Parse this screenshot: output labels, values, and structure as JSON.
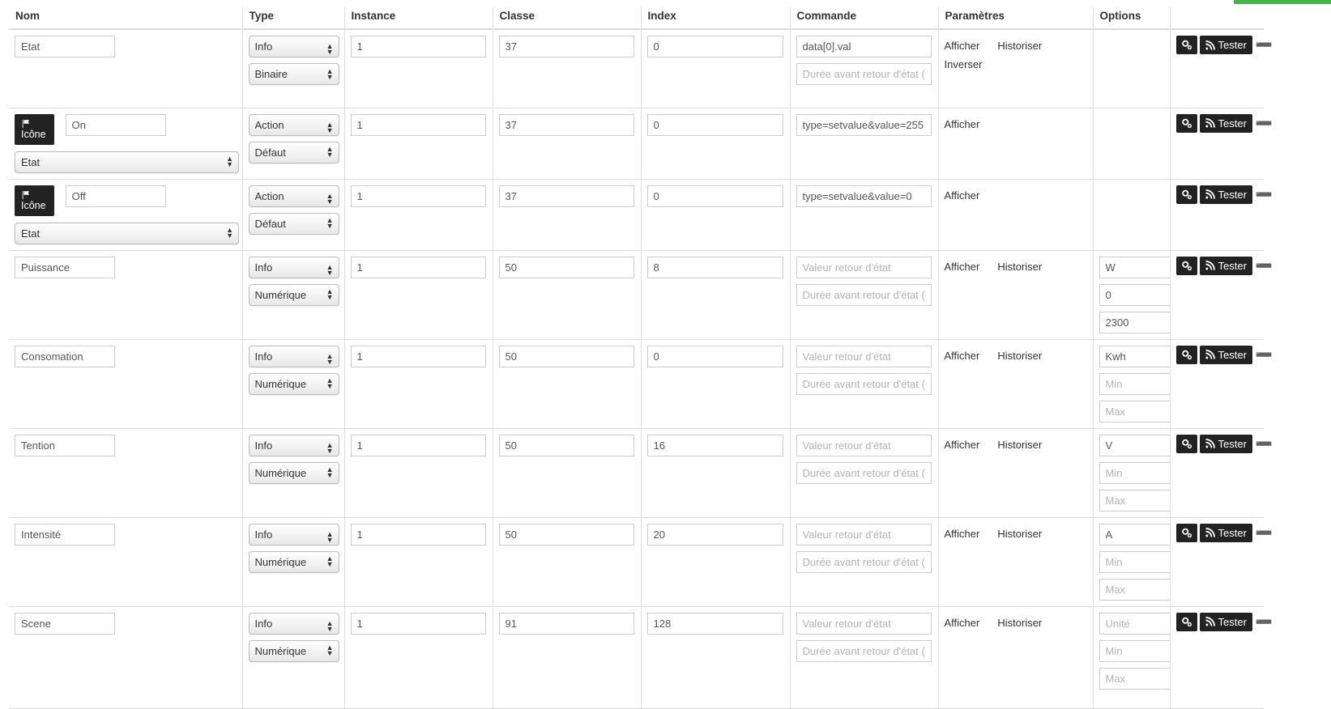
{
  "accent_green": "#44b549",
  "table": {
    "headers": [
      "Nom",
      "Type",
      "Instance",
      "Classe",
      "Index",
      "Commande",
      "Paramètres",
      "Options",
      ""
    ],
    "placeholders": {
      "valeur_retour": "Valeur retour d'état",
      "duree_retour": "Durée avant retour d'état (m",
      "unite": "Unité",
      "min": "Min",
      "max": "Max"
    },
    "buttons": {
      "gear_icon": "gears-icon",
      "test_label": "Tester",
      "test_icon": "rss-icon",
      "remove_icon": "minus-circle-icon"
    },
    "badge_label": "Icône",
    "badge_icon": "flag-icon",
    "rows": [
      {
        "kind": "plain",
        "nom": "Etat",
        "type1": "Info",
        "type2": "Binaire",
        "instance": "1",
        "classe": "37",
        "index": "0",
        "cmd1": "data[0].val",
        "cmd1_placeholder": "Valeur retour d'état",
        "cmd2": "",
        "params": [
          "Afficher",
          "Historiser",
          "Inverser"
        ],
        "options": []
      },
      {
        "kind": "icon",
        "nom": "On",
        "icon_select": "Etat",
        "type1": "Action",
        "type2": "Défaut",
        "instance": "1",
        "classe": "37",
        "index": "0",
        "cmd1": "type=setvalue&value=255",
        "cmd1_placeholder": "Valeur retour d'état",
        "params": [
          "Afficher"
        ],
        "options": []
      },
      {
        "kind": "icon",
        "nom": "Off",
        "icon_select": "Etat",
        "type1": "Action",
        "type2": "Défaut",
        "instance": "1",
        "classe": "37",
        "index": "0",
        "cmd1": "type=setvalue&value=0",
        "cmd1_placeholder": "Valeur retour d'état",
        "params": [
          "Afficher"
        ],
        "options": []
      },
      {
        "kind": "plain",
        "nom": "Puissance",
        "type1": "Info",
        "type2": "Numérique",
        "instance": "1",
        "classe": "50",
        "index": "8",
        "cmd1": "",
        "cmd1_placeholder": "Valeur retour d'état",
        "cmd2": "",
        "params": [
          "Afficher",
          "Historiser"
        ],
        "options": [
          {
            "value": "W",
            "placeholder": "Unité"
          },
          {
            "value": "0",
            "placeholder": "Min"
          },
          {
            "value": "2300",
            "placeholder": "Max"
          }
        ]
      },
      {
        "kind": "plain",
        "nom": "Consomation",
        "type1": "Info",
        "type2": "Numérique",
        "instance": "1",
        "classe": "50",
        "index": "0",
        "cmd1": "",
        "cmd1_placeholder": "Valeur retour d'état",
        "cmd2": "",
        "params": [
          "Afficher",
          "Historiser"
        ],
        "options": [
          {
            "value": "Kwh",
            "placeholder": "Unité"
          },
          {
            "value": "",
            "placeholder": "Min"
          },
          {
            "value": "",
            "placeholder": "Max"
          }
        ]
      },
      {
        "kind": "plain",
        "nom": "Tention",
        "type1": "Info",
        "type2": "Numérique",
        "instance": "1",
        "classe": "50",
        "index": "16",
        "cmd1": "",
        "cmd1_placeholder": "Valeur retour d'état",
        "cmd2": "",
        "params": [
          "Afficher",
          "Historiser"
        ],
        "options": [
          {
            "value": "V",
            "placeholder": "Unité"
          },
          {
            "value": "",
            "placeholder": "Min"
          },
          {
            "value": "",
            "placeholder": "Max"
          }
        ]
      },
      {
        "kind": "plain",
        "nom": "Intensité",
        "type1": "Info",
        "type2": "Numérique",
        "instance": "1",
        "classe": "50",
        "index": "20",
        "cmd1": "",
        "cmd1_placeholder": "Valeur retour d'état",
        "cmd2": "",
        "params": [
          "Afficher",
          "Historiser"
        ],
        "options": [
          {
            "value": "A",
            "placeholder": "Unité"
          },
          {
            "value": "",
            "placeholder": "Min"
          },
          {
            "value": "",
            "placeholder": "Max"
          }
        ]
      },
      {
        "kind": "plain",
        "nom": "Scene",
        "type1": "Info",
        "type2": "Numérique",
        "instance": "1",
        "classe": "91",
        "index": "128",
        "cmd1": "",
        "cmd1_placeholder": "Valeur retour d'état",
        "cmd2": "",
        "params": [
          "Afficher",
          "Historiser"
        ],
        "options": [
          {
            "value": "",
            "placeholder": "Unité"
          },
          {
            "value": "",
            "placeholder": "Min"
          },
          {
            "value": "",
            "placeholder": "Max"
          }
        ]
      }
    ]
  }
}
